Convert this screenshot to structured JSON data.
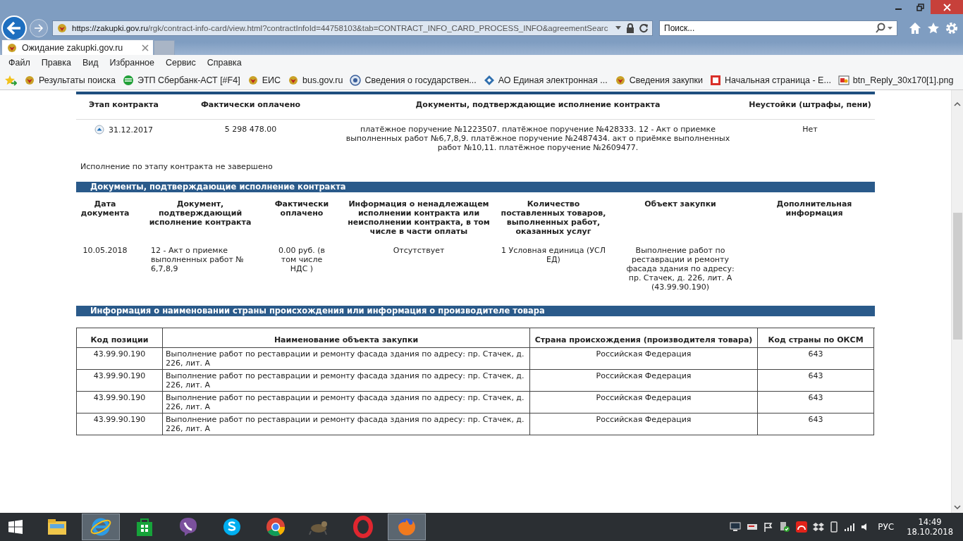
{
  "browser": {
    "address_host": "https://zakupki.gov.ru",
    "address_path": "/rgk/contract-info-card/view.html?contractInfoId=44758103&tab=CONTRACT_INFO_CARD_PROCESS_INFO&agreementSearc",
    "search_placeholder": "Поиск...",
    "tabs": [
      {
        "title": "Ожидание zakupki.gov.ru",
        "selected": true
      }
    ],
    "menu": [
      "Файл",
      "Правка",
      "Вид",
      "Избранное",
      "Сервис",
      "Справка"
    ],
    "favorites": [
      {
        "kind": "emblem",
        "label": "Результаты поиска"
      },
      {
        "kind": "sber",
        "label": "ЭТП Сбербанк-АСТ [#F4]"
      },
      {
        "kind": "emblem",
        "label": "ЕИС"
      },
      {
        "kind": "emblem",
        "label": "bus.gov.ru"
      },
      {
        "kind": "seal",
        "label": "Сведения о государствен..."
      },
      {
        "kind": "diamond",
        "label": "АО Единая электронная ..."
      },
      {
        "kind": "emblem",
        "label": "Сведения закупки"
      },
      {
        "kind": "stc",
        "label": "Начальная страница - Е..."
      },
      {
        "kind": "image",
        "label": "btn_Reply_30x170[1].png"
      }
    ]
  },
  "stages": {
    "columns": [
      "Этап контракта",
      "Фактически оплачено",
      "Документы, подтверждающие исполнение контракта",
      "Неустойки (штрафы, пени)"
    ],
    "rows": [
      {
        "expanded": true,
        "date": "31.12.2017",
        "paid": "5 298 478.00",
        "documents": "платёжное поручение №1223507. платёжное поручение №428333. 12 - Акт о приемке выполненных работ №6,7,8,9. платёжное поручение №2487434. акт о приёмке выполненных работ №10,11. платёжное поручение №2609477.",
        "penalties": "Нет"
      }
    ],
    "note": "Исполнение по этапу контракта не завершено"
  },
  "documents": {
    "title": "Документы, подтверждающие исполнение контракта",
    "columns": [
      "Дата документа",
      "Документ, подтверждающий исполнение контракта",
      "Фактически оплачено",
      "Информация о ненадлежащем исполнении контракта или неисполнении контракта, в том числе в части оплаты",
      "Количество поставленных товаров, выполненных работ, оказанных услуг",
      "Объект закупки",
      "Дополнительная информация"
    ],
    "rows": [
      [
        "10.05.2018",
        "12 - Акт о приемке выполненных работ № 6,7,8,9",
        "0.00 руб. (в том числе НДС )",
        "Отсутствует",
        "1 Условная единица (УСЛ ЕД)",
        "Выполнение работ по реставрации и ремонту фасада здания по адресу: пр. Стачек, д. 226, лит. А (43.99.90.190)"
      ]
    ]
  },
  "origin": {
    "title": "Информация о наименовании страны происхождения или информация о производителе товара",
    "columns": [
      "Код позиции",
      "Наименование объекта закупки",
      "Страна происхождения (производителя товара)",
      "Код страны по ОКСМ"
    ],
    "rows": [
      [
        "43.99.90.190",
        "Выполнение работ по реставрации и ремонту фасада здания по адресу: пр. Стачек, д. 226, лит. А",
        "Российская Федерация",
        "643"
      ],
      [
        "43.99.90.190",
        "Выполнение работ по реставрации и ремонту фасада здания по адресу: пр. Стачек, д. 226, лит. А",
        "Российская Федерация",
        "643"
      ],
      [
        "43.99.90.190",
        "Выполнение работ по реставрации и ремонту фасада здания по адресу: пр. Стачек, д. 226, лит. А",
        "Российская Федерация",
        "643"
      ],
      [
        "43.99.90.190",
        "Выполнение работ по реставрации и ремонту фасада здания по адресу: пр. Стачек, д. 226, лит. А",
        "Российская Федерация",
        "643"
      ]
    ]
  },
  "taskbar": {
    "apps": [
      {
        "kind": "explorer",
        "active": false
      },
      {
        "kind": "ie",
        "active": true
      },
      {
        "kind": "store",
        "active": false
      },
      {
        "kind": "viber",
        "active": false
      },
      {
        "kind": "skype",
        "active": false
      },
      {
        "kind": "chrome",
        "active": false
      },
      {
        "kind": "gimp",
        "active": false
      },
      {
        "kind": "opera",
        "active": false
      },
      {
        "kind": "firefox",
        "active": true
      }
    ],
    "language": "РУС",
    "time": "14:49",
    "date": "18.10.2018"
  }
}
